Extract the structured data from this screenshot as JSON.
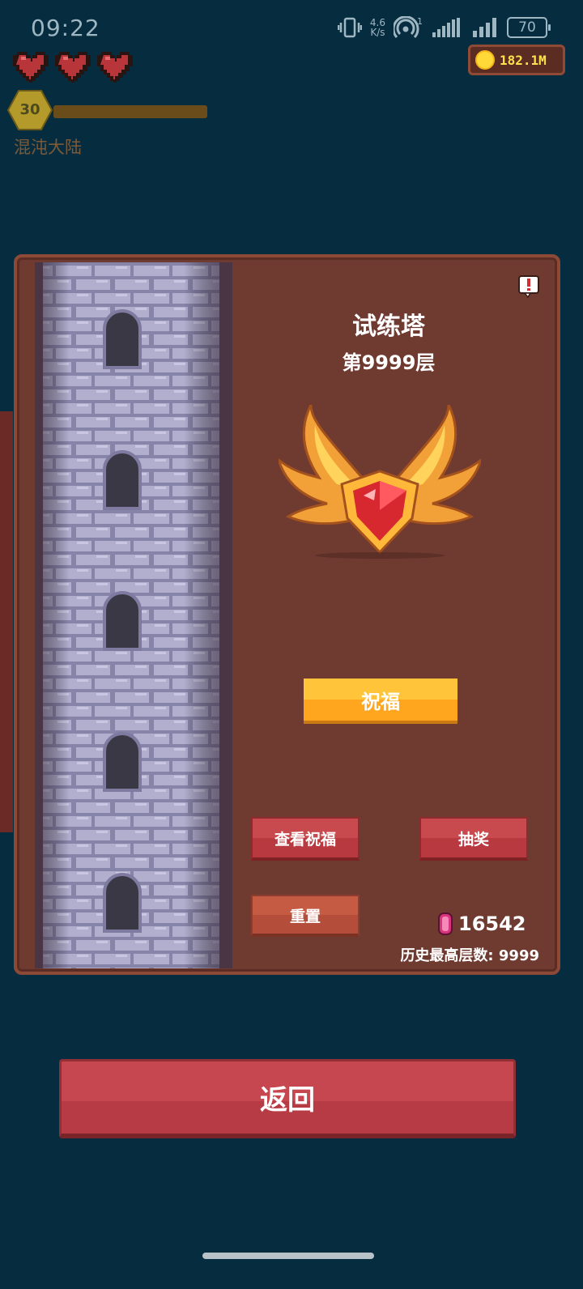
{
  "status_bar": {
    "time": "09:22",
    "net_speed_value": "4.6",
    "net_speed_unit": "K/s",
    "signal_label": "1",
    "battery": "70"
  },
  "hud": {
    "hearts": 3,
    "gold": "182.1M",
    "level": "30",
    "region": "混沌大陆"
  },
  "panel": {
    "title": "试练塔",
    "floor": "第9999层",
    "bless_label": "祝福",
    "view_bless_label": "查看祝福",
    "lottery_label": "抽奖",
    "reset_label": "重置",
    "gems": "16542",
    "history_best": "历史最高层数: 9999"
  },
  "footer": {
    "back_label": "返回"
  },
  "colors": {
    "background": "#062d3f",
    "panel": "#6f3a30",
    "gold_button": "#ffb02a",
    "red_button": "#c0434a",
    "gold_text": "#ffe24a"
  }
}
